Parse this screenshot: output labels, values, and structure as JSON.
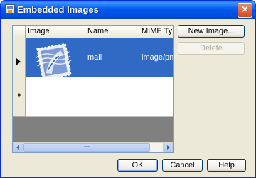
{
  "window": {
    "title": "Embedded Images",
    "close_glyph": "×"
  },
  "grid": {
    "columns": [
      "Image",
      "Name",
      "MIME Type"
    ],
    "rows": [
      {
        "image_icon": "mail-stamp-icon",
        "name": "mail",
        "mime_type": "image/png",
        "selected": true
      }
    ],
    "new_row_marker": "*",
    "scrollbar_thumb_fraction": 0.87
  },
  "buttons": {
    "new_image": "New Image...",
    "delete": "Delete",
    "ok": "OK",
    "cancel": "Cancel",
    "help": "Help"
  },
  "colors": {
    "titlebar": "#0058ee",
    "selection": "#316ac5",
    "grid_background": "#808080",
    "dialog_background": "#ece9d8"
  }
}
